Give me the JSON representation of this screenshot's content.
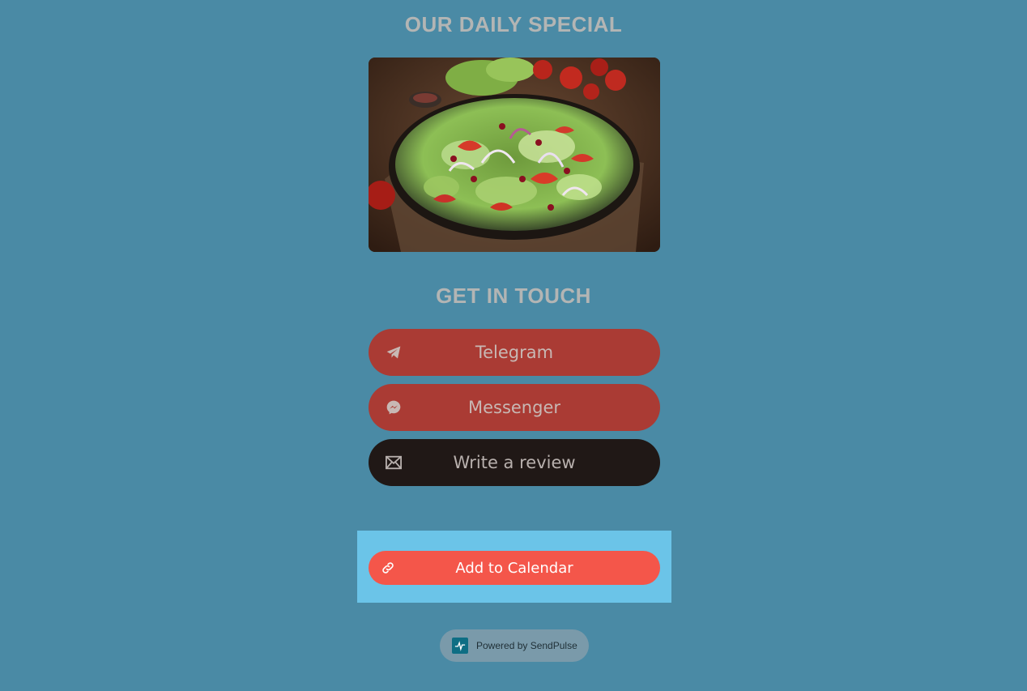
{
  "sections": {
    "special_title": "OUR DAILY SPECIAL",
    "touch_title": "GET IN TOUCH"
  },
  "photo": {
    "subject": "salad bowl with tomatoes, onion and lettuce"
  },
  "buttons": {
    "telegram": {
      "label": "Telegram",
      "icon": "paper-plane-icon",
      "color": "#aa3b34"
    },
    "messenger": {
      "label": "Messenger",
      "icon": "messenger-icon",
      "color": "#aa3b34"
    },
    "review": {
      "label": "Write a review",
      "icon": "envelope-icon",
      "color": "#201816"
    },
    "calendar": {
      "label": "Add to Calendar",
      "icon": "link-icon",
      "color": "#f4564a"
    }
  },
  "footer": {
    "powered_by": "Powered by SendPulse",
    "logo_icon": "pulse-logo-icon"
  },
  "colors": {
    "background": "#4a8aa5",
    "calendar_panel": "#6bc4e8"
  }
}
